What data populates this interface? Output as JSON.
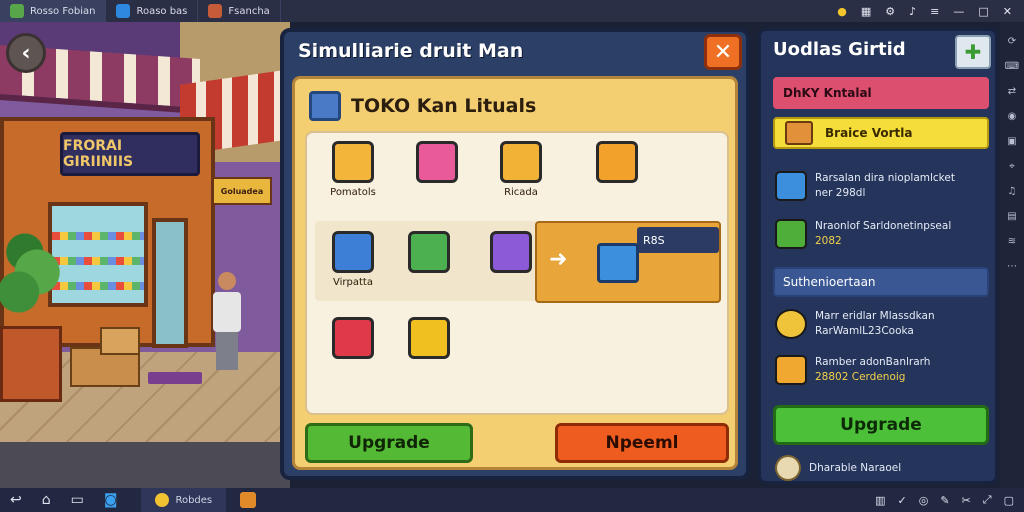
{
  "topbar": {
    "tabs": [
      {
        "label": "Rosso Fobian",
        "active": true
      },
      {
        "label": "Roaso bas",
        "active": false
      },
      {
        "label": "Fsancha",
        "active": false
      }
    ],
    "right_icons": [
      "coin-icon",
      "grid-icon",
      "settings-icon",
      "bell-icon",
      "menu-icon",
      "minimize-icon",
      "maximize-icon",
      "close-icon"
    ]
  },
  "scene": {
    "shop_sign": "FRORAI GIRIINIIS",
    "side_sign": "Goluadea"
  },
  "dialog": {
    "title": "Simulliarie druit Man",
    "close_label": "✕",
    "section_title": "TOKO Kan Lituals",
    "items": [
      {
        "label": "Pomatols",
        "color": "#f4b63a"
      },
      {
        "label": "",
        "color": "#e85a9a"
      },
      {
        "label": "Ricada",
        "color": "#f2b235"
      },
      {
        "label": "",
        "color": "#f2a12b"
      },
      {
        "label": "Virpatta",
        "color": "#3d7fd6"
      },
      {
        "label": "",
        "color": "#4caf50"
      },
      {
        "label": "",
        "color": "#8c5ad6"
      },
      {
        "label": "",
        "color": "#e03a4a"
      },
      {
        "label": "",
        "color": "#f0c020"
      }
    ],
    "promo_tag": "R8S",
    "promo_arrow": "➜",
    "btn_upgrade": "Upgrade",
    "btn_other": "Npeeml"
  },
  "panel": {
    "title": "Uodlas Girtid",
    "red_bar": "DhKY Kntalal",
    "yellow_bar": "Braice Vortla",
    "rows": [
      {
        "line1": "Rarsalan dira nioplamlcket",
        "line2": "ner 298dl",
        "color": "#3b8fdc"
      },
      {
        "line1": "Nraonlof Sarldonetinpseal",
        "line2": "2082",
        "color": "#4fae3a"
      }
    ],
    "section": "Suthenioertaan",
    "rows2": [
      {
        "line1": "Marr eridlar Mlassdkan",
        "line2": "RarWamlL23Cooka",
        "color": "#f0c43a"
      },
      {
        "line1": "Ramber adonBanlrarh",
        "line2": "28802 Cerdenoig",
        "color": "#f0a830"
      }
    ],
    "upgrade": "Upgrade",
    "foot": "Dharable Naraoel"
  },
  "bottombar": {
    "app_label": "Robdes"
  }
}
